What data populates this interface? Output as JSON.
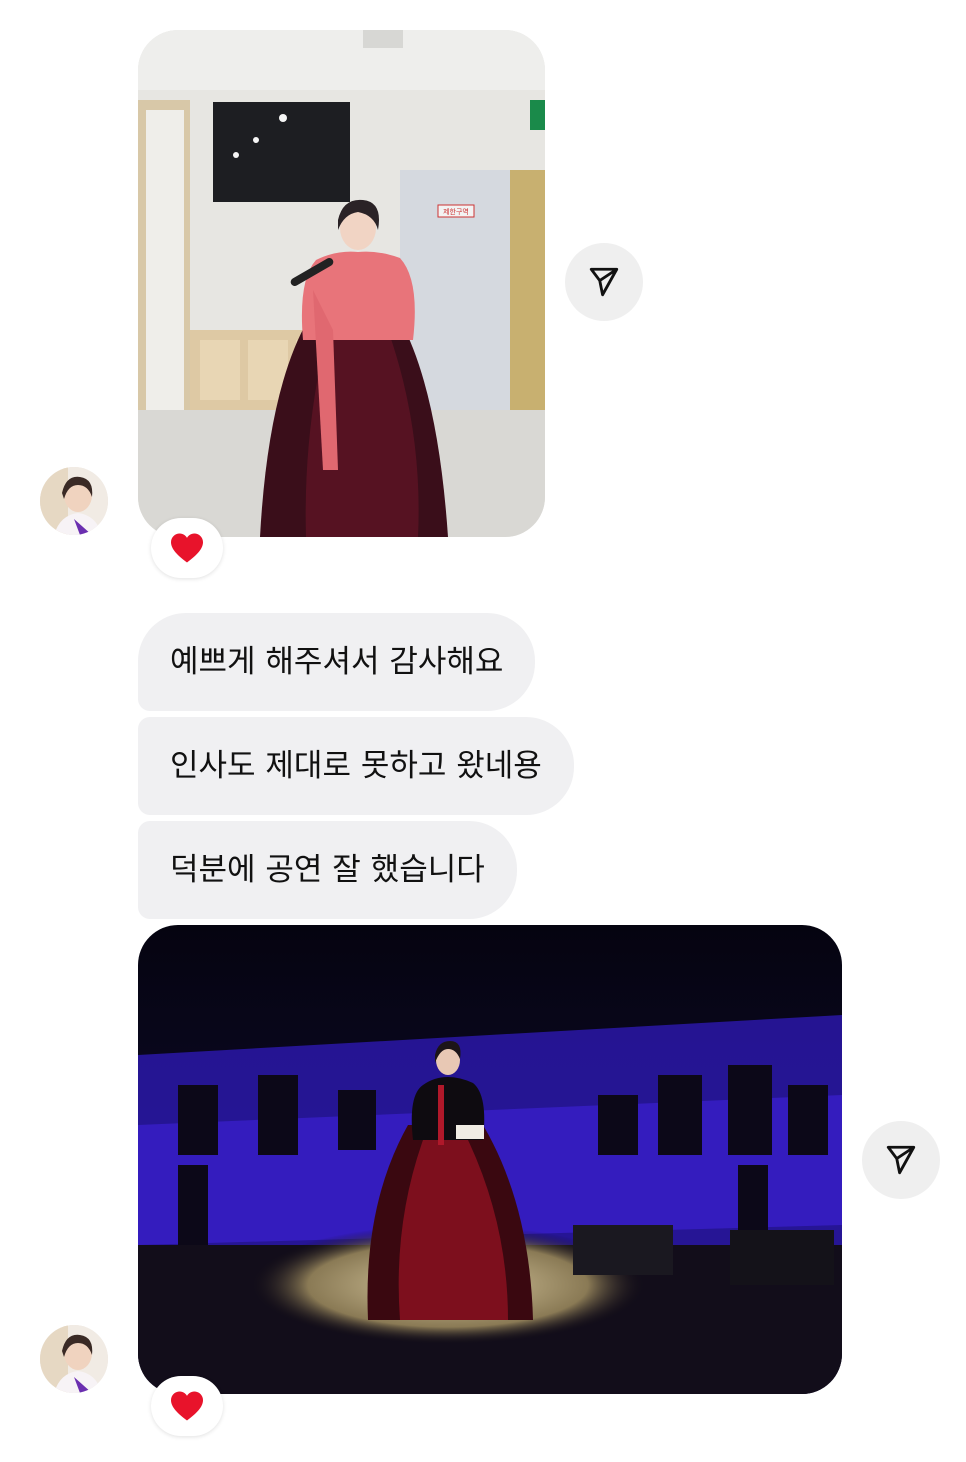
{
  "thread": {
    "messages": [
      {
        "type": "photo",
        "alt": "",
        "reaction": "❤️"
      },
      {
        "type": "text",
        "text": "예쁘게 해주셔서 감사해요"
      },
      {
        "type": "text",
        "text": "인사도 제대로 못하고 왔네용"
      },
      {
        "type": "text",
        "text": "덕분에 공연 잘 했습니다"
      },
      {
        "type": "photo",
        "alt": "",
        "reaction": "❤️"
      }
    ],
    "photo1_sign": "제한구역"
  },
  "icons": {
    "share": "paper-plane-icon",
    "reaction": "heart-icon",
    "avatar": "profile-avatar"
  },
  "colors": {
    "bubble_bg": "#f0f0f2",
    "heart": "#e8132b",
    "stage_light": "#3b1fb8"
  }
}
